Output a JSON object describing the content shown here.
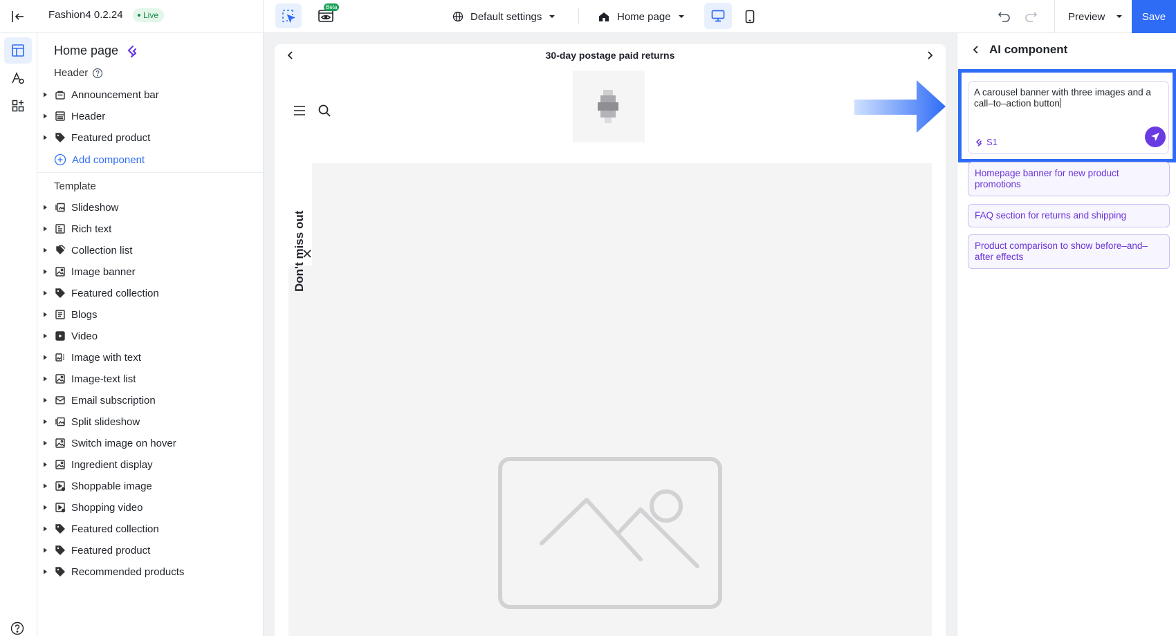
{
  "app": {
    "name": "Fashion4",
    "version": "0.2.24",
    "status": "Live"
  },
  "toolbar": {
    "beta_label": "Beta",
    "settings_label": "Default settings",
    "page_label": "Home page",
    "preview_label": "Preview",
    "save_label": "Save"
  },
  "sidebar": {
    "title": "Home page",
    "header_section": "Header",
    "header_items": [
      {
        "label": "Announcement bar",
        "icon": "announcement-icon"
      },
      {
        "label": "Header",
        "icon": "header-layout-icon"
      },
      {
        "label": "Featured product",
        "icon": "tag-icon"
      }
    ],
    "add_component": "Add component",
    "template_section": "Template",
    "template_items": [
      {
        "label": "Slideshow",
        "icon": "slideshow-icon"
      },
      {
        "label": "Rich text",
        "icon": "rich-text-icon"
      },
      {
        "label": "Collection list",
        "icon": "collection-tags-icon"
      },
      {
        "label": "Image banner",
        "icon": "image-icon"
      },
      {
        "label": "Featured collection",
        "icon": "tag-icon"
      },
      {
        "label": "Blogs",
        "icon": "blogs-icon"
      },
      {
        "label": "Video",
        "icon": "video-icon"
      },
      {
        "label": "Image with text",
        "icon": "image-text-icon"
      },
      {
        "label": "Image-text list",
        "icon": "image-icon"
      },
      {
        "label": "Email subscription",
        "icon": "email-icon"
      },
      {
        "label": "Split slideshow",
        "icon": "slideshow-icon"
      },
      {
        "label": "Switch image on hover",
        "icon": "image-icon"
      },
      {
        "label": "Ingredient display",
        "icon": "image-icon"
      },
      {
        "label": "Shoppable image",
        "icon": "shoppable-icon"
      },
      {
        "label": "Shopping video",
        "icon": "shoppable-icon"
      },
      {
        "label": "Featured collection",
        "icon": "tag-icon"
      },
      {
        "label": "Featured product",
        "icon": "tag-icon"
      },
      {
        "label": "Recommended products",
        "icon": "tag-icon"
      }
    ]
  },
  "preview": {
    "announcement": "30-day postage paid returns",
    "popup_text": "Don't miss out"
  },
  "ai_panel": {
    "title": "AI component",
    "prompt": "A carousel banner with three images and a call–to–action button",
    "model": "S1",
    "suggestions": [
      "Homepage banner for new product promotions",
      "FAQ section for returns and shipping",
      "Product comparison to show before–and–after effects"
    ]
  },
  "colors": {
    "accent": "#2f6cf6",
    "ai_purple": "#6b3be2",
    "live_green": "#1a8a48"
  }
}
